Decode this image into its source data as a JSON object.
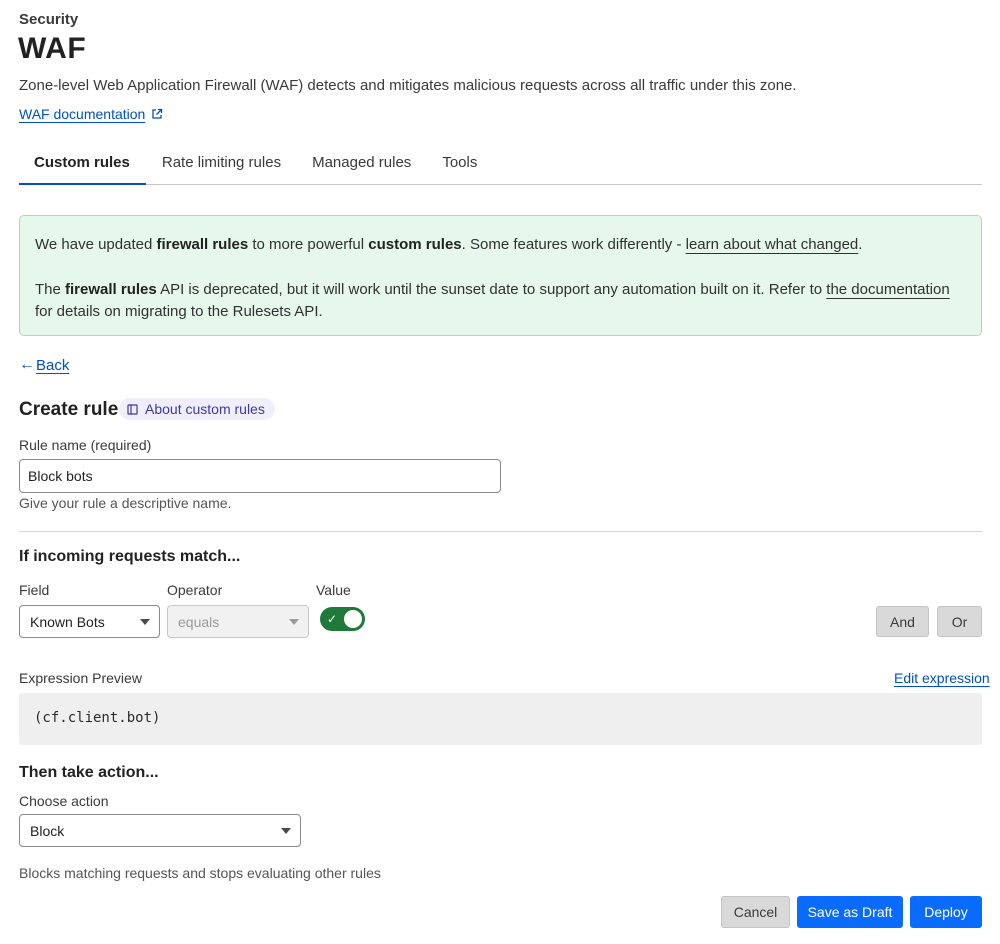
{
  "header": {
    "section": "Security",
    "title": "WAF",
    "description": "Zone-level Web Application Firewall (WAF) detects and mitigates malicious requests across all traffic under this zone.",
    "doc_link": "WAF documentation"
  },
  "tabs": [
    {
      "label": "Custom rules",
      "active": true
    },
    {
      "label": "Rate limiting rules",
      "active": false
    },
    {
      "label": "Managed rules",
      "active": false
    },
    {
      "label": "Tools",
      "active": false
    }
  ],
  "notice": {
    "line1_a": "We have updated ",
    "line1_b": "firewall rules",
    "line1_c": " to more powerful ",
    "line1_d": "custom rules",
    "line1_e": ". Some features work differently - ",
    "line1_link": "learn about what changed",
    "line1_f": ".",
    "line2_a": "The ",
    "line2_b": "firewall rules",
    "line2_c": " API is deprecated, but it will work until the sunset date to support any automation built on it. Refer to ",
    "line2_link": "the documentation",
    "line2_d": " for details on migrating to the Rulesets API."
  },
  "back": {
    "arrow": "←",
    "label": "Back"
  },
  "create": {
    "title": "Create rule",
    "about_chip": "About custom rules"
  },
  "rule_name": {
    "label": "Rule name (required)",
    "value": "Block bots",
    "hint": "Give your rule a descriptive name."
  },
  "match": {
    "heading": "If incoming requests match...",
    "field_label": "Field",
    "field_value": "Known Bots",
    "operator_label": "Operator",
    "operator_value": "equals",
    "value_label": "Value",
    "value_toggle_on": true,
    "and_button": "And",
    "or_button": "Or"
  },
  "expression": {
    "label": "Expression Preview",
    "edit_link": "Edit expression",
    "code": "(cf.client.bot)"
  },
  "action": {
    "heading": "Then take action...",
    "label": "Choose action",
    "value": "Block",
    "hint": "Blocks matching requests and stops evaluating other rules"
  },
  "footer": {
    "cancel": "Cancel",
    "save_draft": "Save as Draft",
    "deploy": "Deploy"
  },
  "colors": {
    "link": "#0051c3",
    "primary": "#0a6cff",
    "toggle_on": "#1f7a3a",
    "notice_bg": "#e6f7ec"
  }
}
